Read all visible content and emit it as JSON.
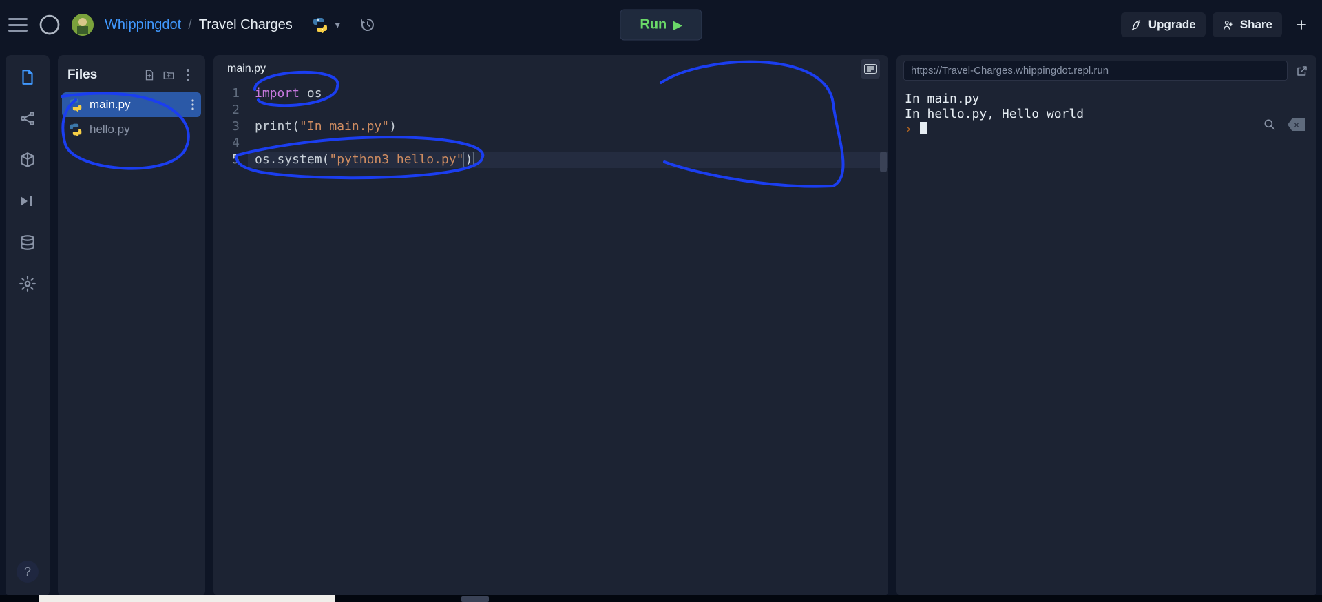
{
  "header": {
    "username": "Whippingdot",
    "separator": "/",
    "project": "Travel Charges",
    "run_label": "Run",
    "upgrade_label": "Upgrade",
    "share_label": "Share"
  },
  "sidebar_rail": {
    "items": [
      {
        "name": "files-tab",
        "active": true
      },
      {
        "name": "version-control-tab",
        "active": false
      },
      {
        "name": "packages-tab",
        "active": false
      },
      {
        "name": "debugger-tab",
        "active": false
      },
      {
        "name": "database-tab",
        "active": false
      },
      {
        "name": "settings-tab",
        "active": false
      }
    ],
    "help_label": "?"
  },
  "files_panel": {
    "title": "Files",
    "items": [
      {
        "name": "main.py",
        "selected": true
      },
      {
        "name": "hello.py",
        "selected": false
      }
    ]
  },
  "editor": {
    "tab": "main.py",
    "active_line": 5,
    "lines": [
      {
        "n": 1,
        "tokens": [
          [
            "kw",
            "import"
          ],
          [
            "pl",
            " os"
          ]
        ]
      },
      {
        "n": 2,
        "tokens": []
      },
      {
        "n": 3,
        "tokens": [
          [
            "pl",
            "print("
          ],
          [
            "str",
            "\"In main.py\""
          ],
          [
            "pl",
            ")"
          ]
        ]
      },
      {
        "n": 4,
        "tokens": []
      },
      {
        "n": 5,
        "tokens": [
          [
            "pl",
            "os.system"
          ],
          [
            "pl",
            "("
          ],
          [
            "str",
            "\"python3 hello.py\""
          ],
          [
            "pl-match",
            ")"
          ]
        ]
      }
    ]
  },
  "output": {
    "url": "https://Travel-Charges.whippingdot.repl.run",
    "lines": [
      "In main.py",
      "In hello.py, Hello world"
    ],
    "prompt": "› "
  }
}
